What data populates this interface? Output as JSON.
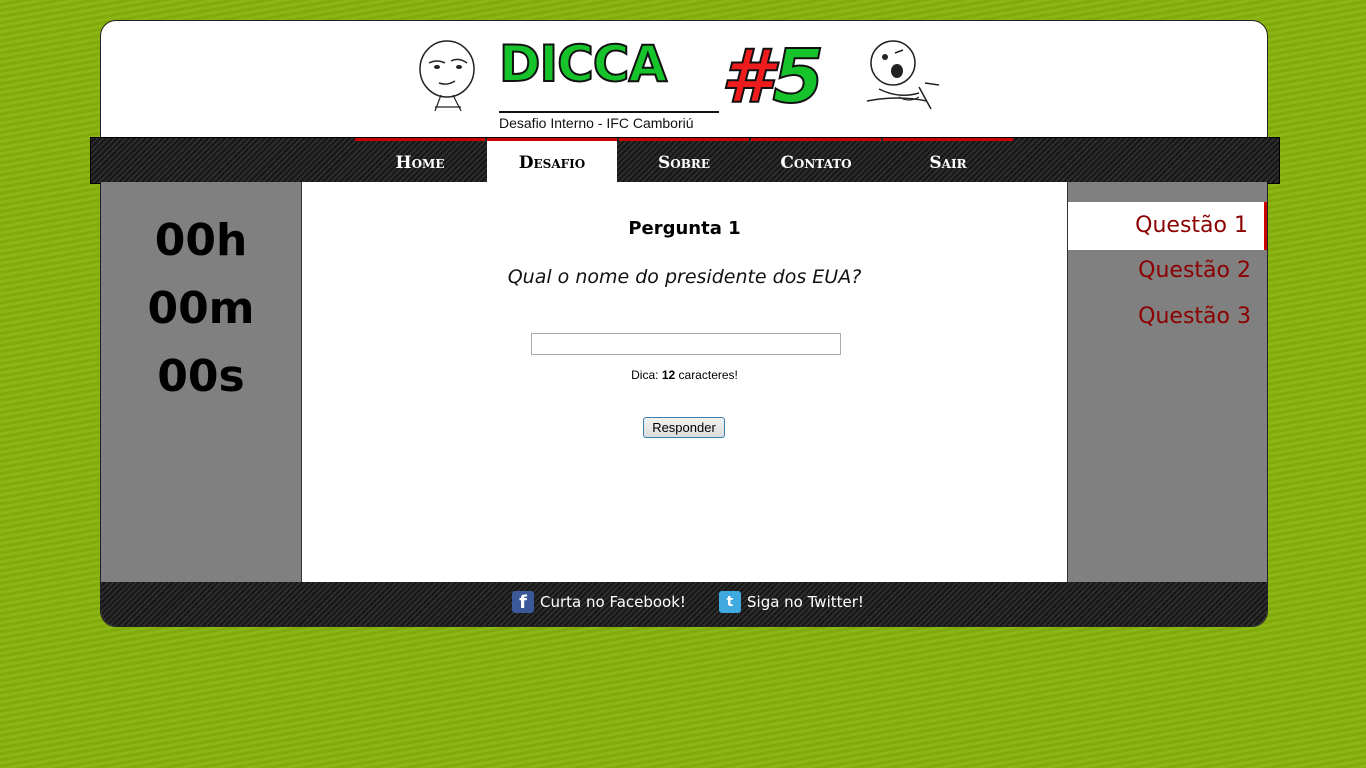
{
  "logo": {
    "title": "DICCA",
    "hash": "#",
    "number": "5",
    "subtitle": "Desafio Interno - IFC Camboriú"
  },
  "nav": {
    "items": [
      "Home",
      "Desafio",
      "Sobre",
      "Contato",
      "Sair"
    ],
    "active": "Desafio"
  },
  "timer": {
    "hours": "00h",
    "minutes": "00m",
    "seconds": "00s"
  },
  "question": {
    "title": "Pergunta 1",
    "text": "Qual o nome do presidente dos EUA?",
    "answer_value": "",
    "hint_prefix": "Dica:",
    "hint_count": "12",
    "hint_suffix": "caracteres!",
    "submit_label": "Responder"
  },
  "sidebar": {
    "items": [
      "Questão 1",
      "Questão 2",
      "Questão 3"
    ],
    "active": "Questão 1"
  },
  "footer": {
    "facebook_label": "Curta no Facebook!",
    "twitter_label": "Siga no Twitter!",
    "facebook_icon": "facebook-icon",
    "twitter_icon": "twitter-icon"
  },
  "colors": {
    "background": "#86b10a",
    "accent_red": "#cc0000",
    "logo_green": "#17c32a",
    "question_link": "#8b0000",
    "panel_gray": "#808080"
  }
}
